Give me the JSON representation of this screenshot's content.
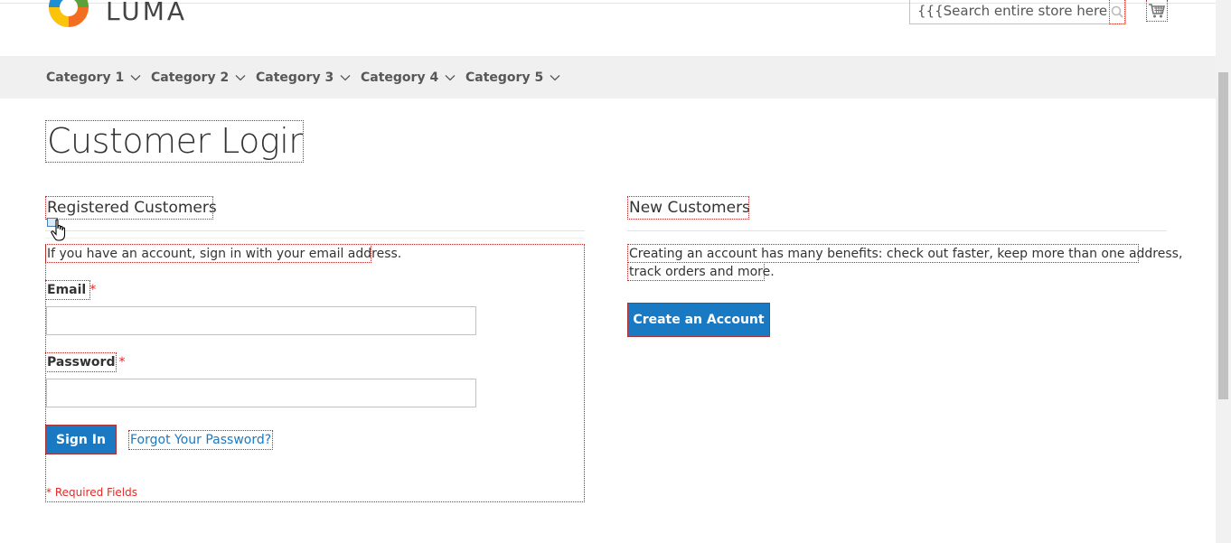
{
  "header": {
    "logo_text": "LUMA",
    "search": {
      "value": "{{{Search entire store here..."
    },
    "cart_icon": "cart-icon",
    "search_icon": "magnifier-icon"
  },
  "nav": {
    "items": [
      {
        "label": "Category 1"
      },
      {
        "label": "Category 2"
      },
      {
        "label": "Category 3"
      },
      {
        "label": "Category 4"
      },
      {
        "label": "Category 5"
      }
    ]
  },
  "page": {
    "title": "Customer Login"
  },
  "registered": {
    "title": "Registered Customers",
    "note": "If you have an account, sign in with your email address.",
    "email_label": "Email",
    "password_label": "Password",
    "required_mark": "*",
    "sign_in_label": "Sign In",
    "forgot_label": "Forgot Your Password?",
    "required_note": "* Required Fields"
  },
  "new_customers": {
    "title": "New Customers",
    "note_line1": "Creating an account has many benefits: check out faster, keep more than one address,",
    "note_line2": "track orders and more.",
    "create_label": "Create an Account"
  },
  "colors": {
    "primary": "#1979c3",
    "required": "#e02b27",
    "nav_bg": "#f0f0f0"
  }
}
